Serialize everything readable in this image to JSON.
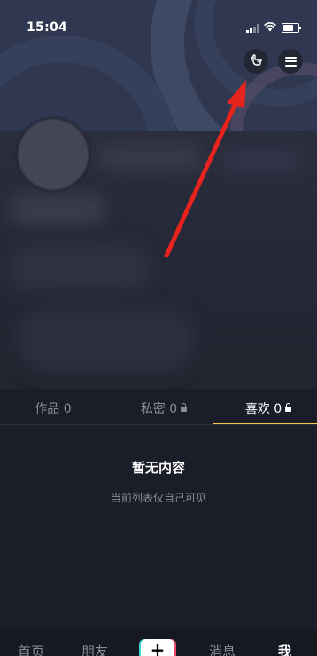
{
  "status_bar": {
    "time": "15:04",
    "icons": [
      "signal-icon",
      "wifi-icon",
      "battery-icon"
    ]
  },
  "header": {
    "buttons": [
      {
        "name": "hand-pointer-button",
        "icon": "hand-pointer-icon"
      },
      {
        "name": "menu-button",
        "icon": "hamburger-menu-icon"
      }
    ]
  },
  "tabs": [
    {
      "label": "作品 0",
      "locked": false,
      "active": false
    },
    {
      "label": "私密 0",
      "locked": true,
      "active": false
    },
    {
      "label": "喜欢 0",
      "locked": true,
      "active": true
    }
  ],
  "empty_state": {
    "title": "暂无内容",
    "subtitle": "当前列表仅自己可见"
  },
  "bottom_nav": {
    "items": [
      {
        "label": "首页",
        "active": false
      },
      {
        "label": "朋友",
        "active": false
      },
      {
        "label": "+",
        "active": false
      },
      {
        "label": "消息",
        "active": false
      },
      {
        "label": "我",
        "active": true
      }
    ]
  },
  "colors": {
    "background": "#1b1d29",
    "active_tab_underline": "#f2c94c",
    "annotation_arrow": "#e8231d"
  }
}
